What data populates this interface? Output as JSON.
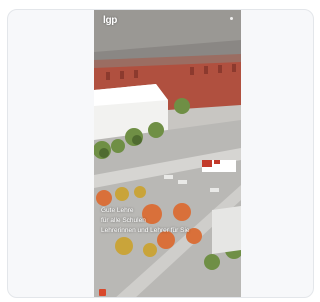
{
  "header": {
    "logo_text": "lgp"
  },
  "caption": {
    "line1": "Gute Lehre",
    "line2": "für alle Schulen",
    "line3": "Lehrerinnen und Lehrer für Sie"
  },
  "colors": {
    "brick": "#b0503f",
    "foliage": "#6f8f45",
    "accent_orange": "#d9703a",
    "page_bg": "#f7f8fa"
  }
}
